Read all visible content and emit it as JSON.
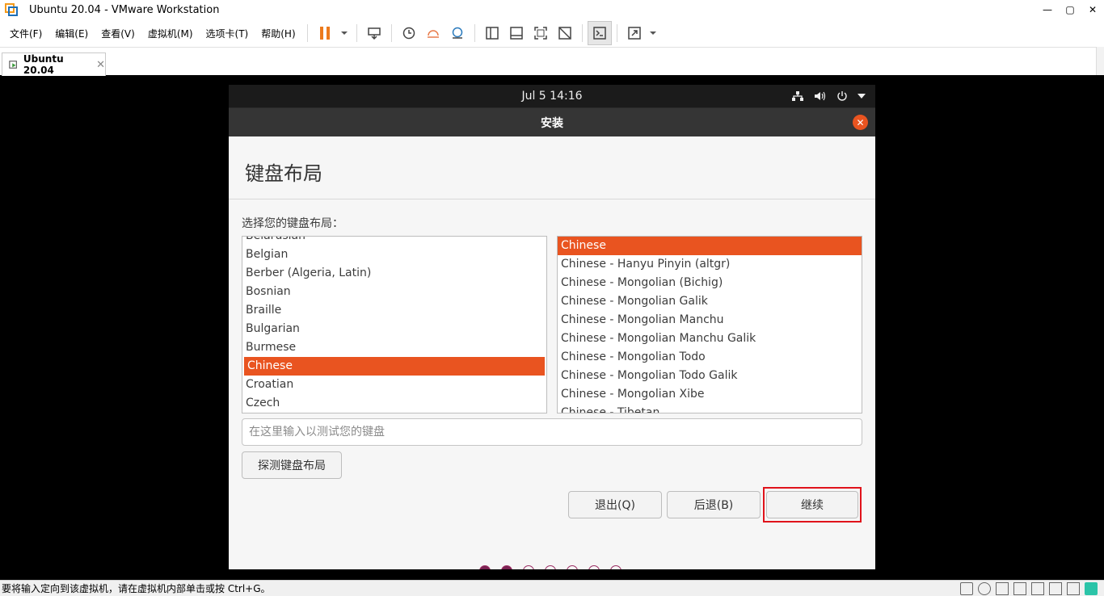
{
  "window": {
    "title": "Ubuntu 20.04 - VMware Workstation"
  },
  "menu": [
    "文件(F)",
    "编辑(E)",
    "查看(V)",
    "虚拟机(M)",
    "选项卡(T)",
    "帮助(H)"
  ],
  "tab": {
    "label": "Ubuntu 20.04",
    "close": "✕"
  },
  "guest": {
    "clock": "Jul 5  14:16",
    "header_title": "安装",
    "page_title": "键盘布局",
    "prompt": "选择您的键盘布局：",
    "left_list": [
      "Belarusian",
      "Belgian",
      "Berber (Algeria, Latin)",
      "Bosnian",
      "Braille",
      "Bulgarian",
      "Burmese",
      "Chinese",
      "Croatian",
      "Czech"
    ],
    "left_selected": "Chinese",
    "right_list": [
      "Chinese",
      "Chinese - Hanyu Pinyin (altgr)",
      "Chinese - Mongolian (Bichig)",
      "Chinese - Mongolian Galik",
      "Chinese - Mongolian Manchu",
      "Chinese - Mongolian Manchu Galik",
      "Chinese - Mongolian Todo",
      "Chinese - Mongolian Todo Galik",
      "Chinese - Mongolian Xibe",
      "Chinese - Tibetan"
    ],
    "right_selected": "Chinese",
    "test_placeholder": "在这里输入以测试您的键盘",
    "detect_button": "探测键盘布局",
    "quit_button": "退出(Q)",
    "back_button": "后退(B)",
    "continue_button": "继续",
    "progress": {
      "total": 7,
      "filled": 2
    }
  },
  "status_text": "要将输入定向到该虚拟机，请在虚拟机内部单击或按 Ctrl+G。",
  "colors": {
    "accent": "#e95420",
    "highlight_box": "#e0131b"
  }
}
